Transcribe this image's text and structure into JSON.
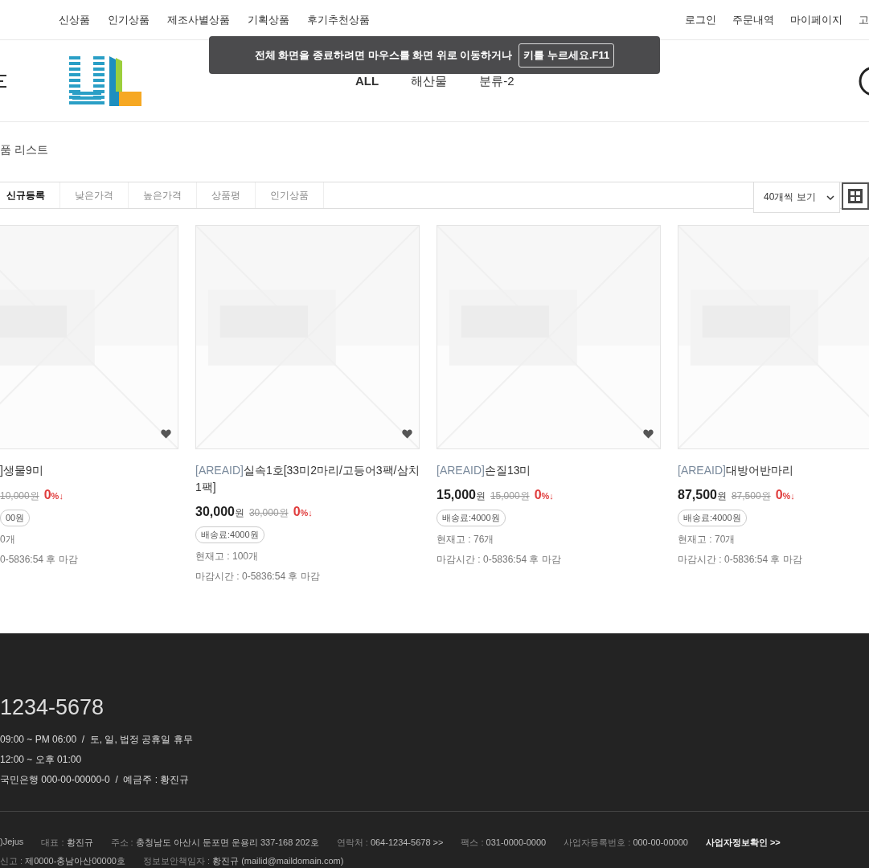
{
  "top_nav": {
    "left": [
      "신상품",
      "인기상품",
      "제조사별상품",
      "기획상품",
      "후기추천상품"
    ],
    "right": [
      "로그인",
      "주문내역",
      "마이페이지",
      "고"
    ]
  },
  "fullscreen_notice": {
    "message": "전체 화면을 종료하려면 마우스를 화면 위로 이동하거나",
    "key_hint": "키를 누르세요.F11"
  },
  "category_nav": [
    "ALL",
    "해산물",
    "분류-2"
  ],
  "breadcrumb": "품 리스트",
  "sort_tabs": [
    {
      "label": "신규등록",
      "selected": true
    },
    {
      "label": "낮은가격",
      "selected": false
    },
    {
      "label": "높은가격",
      "selected": false
    },
    {
      "label": "상품평",
      "selected": false
    },
    {
      "label": "인기상품",
      "selected": false
    }
  ],
  "page_size": "40개씩 보기",
  "products": [
    {
      "wishlist_button": true,
      "name": "]생물9미",
      "old_price": "10,000원",
      "discount": "0",
      "discount_unit": "%↓",
      "shipping": "00원",
      "stock": "0개",
      "deadline": "0-5836:54 후 마감"
    },
    {
      "wishlist_button": true,
      "prefix": "[AREAID]",
      "name": "실속1호[33미2마리/고등어3팩/삼치1팩]",
      "price": "30,000",
      "price_unit": "원",
      "old_price": "30,000원",
      "discount": "0",
      "discount_unit": "%↓",
      "shipping": "배송료:4000원",
      "stock": "현재고 : 100개",
      "deadline": "마감시간 : 0-5836:54 후 마감"
    },
    {
      "wishlist_button": true,
      "prefix": "[AREAID]",
      "name": "손질13미",
      "price": "15,000",
      "price_unit": "원",
      "old_price": "15,000원",
      "discount": "0",
      "discount_unit": "%↓",
      "shipping": "배송료:4000원",
      "stock": "현재고 : 76개",
      "deadline": "마감시간 : 0-5836:54 후 마감"
    },
    {
      "prefix": "[AREAID]",
      "name": "대방어반마리",
      "price": "87,500",
      "price_unit": "원",
      "old_price": "87,500원",
      "discount": "0",
      "discount_unit": "%↓",
      "shipping": "배송료:4000원",
      "stock": "현재고 : 70개",
      "deadline": "마감시간 : 0-5836:54 후 마감"
    }
  ],
  "footer": {
    "phone": "1234-5678",
    "hours": [
      "09:00 ~ PM 06:00  /  토, 일, 법정 공휴일 휴무",
      "12:00 ~ 오후 01:00",
      "국민은행 000-00-00000-0  /  예금주 : 황진규"
    ],
    "info_rows": [
      [
        {
          "value": ")Jejus"
        },
        {
          "label": "대표 :",
          "value": "황진규"
        },
        {
          "label": "주소 :",
          "value": "충청남도 아산시 둔포면 운용리 337-168 202호"
        },
        {
          "label": "연락처 :",
          "value": "064-1234-5678 >>"
        },
        {
          "label": "팩스 :",
          "value": "031-0000-0000"
        },
        {
          "label": "사업자등록번호 :",
          "value": "000-00-00000"
        },
        {
          "value": "사업자정보확인 >>",
          "kind": "link"
        }
      ],
      [
        {
          "label": "신고 :",
          "value": "제0000-충남아산00000호"
        },
        {
          "label": "정보보안책임자 :",
          "value": "황진규 (mailid@maildomain.com)"
        }
      ]
    ]
  }
}
